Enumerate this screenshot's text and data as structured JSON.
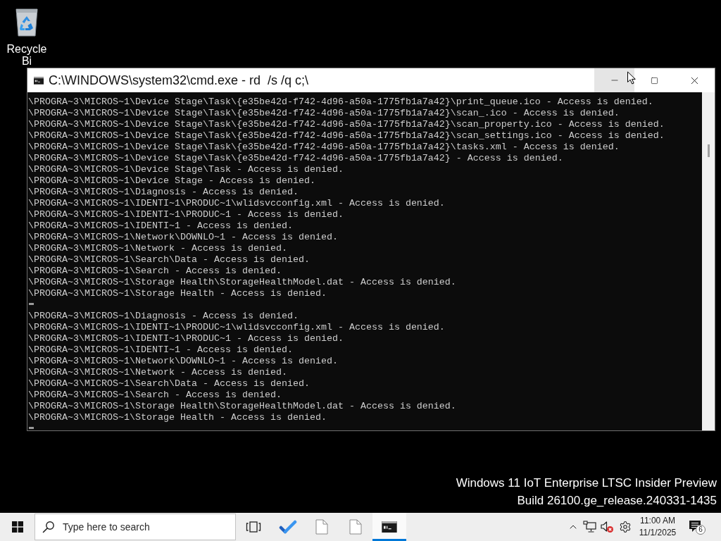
{
  "desktop_icons": [
    {
      "label": "Recycle Bi"
    }
  ],
  "console_window": {
    "title": "C:\\WINDOWS\\system32\\cmd.exe - rd  /s /q c;\\",
    "title_buttons": [
      {
        "kind": "minimize",
        "hovered": true
      },
      {
        "kind": "maximize",
        "hovered": false
      },
      {
        "kind": "close",
        "hovered": false
      }
    ],
    "lines": [
      {
        "kind": "text",
        "text": "\\PROGRA~3\\MICROS~1\\Device Stage\\Task\\{e35be42d-f742-4d96-a50a-1775fb1a7a42}\\print_queue.ico - Access is denied."
      },
      {
        "kind": "text",
        "text": "\\PROGRA~3\\MICROS~1\\Device Stage\\Task\\{e35be42d-f742-4d96-a50a-1775fb1a7a42}\\scan_.ico - Access is denied."
      },
      {
        "kind": "text",
        "text": "\\PROGRA~3\\MICROS~1\\Device Stage\\Task\\{e35be42d-f742-4d96-a50a-1775fb1a7a42}\\scan_property.ico - Access is denied."
      },
      {
        "kind": "text",
        "text": "\\PROGRA~3\\MICROS~1\\Device Stage\\Task\\{e35be42d-f742-4d96-a50a-1775fb1a7a42}\\scan_settings.ico - Access is denied."
      },
      {
        "kind": "text",
        "text": "\\PROGRA~3\\MICROS~1\\Device Stage\\Task\\{e35be42d-f742-4d96-a50a-1775fb1a7a42}\\tasks.xml - Access is denied."
      },
      {
        "kind": "text",
        "text": "\\PROGRA~3\\MICROS~1\\Device Stage\\Task\\{e35be42d-f742-4d96-a50a-1775fb1a7a42} - Access is denied."
      },
      {
        "kind": "text",
        "text": "\\PROGRA~3\\MICROS~1\\Device Stage\\Task - Access is denied."
      },
      {
        "kind": "text",
        "text": "\\PROGRA~3\\MICROS~1\\Device Stage - Access is denied."
      },
      {
        "kind": "text",
        "text": "\\PROGRA~3\\MICROS~1\\Diagnosis - Access is denied."
      },
      {
        "kind": "text",
        "text": "\\PROGRA~3\\MICROS~1\\IDENTI~1\\PRODUC~1\\wlidsvcconfig.xml - Access is denied."
      },
      {
        "kind": "text",
        "text": "\\PROGRA~3\\MICROS~1\\IDENTI~1\\PRODUC~1 - Access is denied."
      },
      {
        "kind": "text",
        "text": "\\PROGRA~3\\MICROS~1\\IDENTI~1 - Access is denied."
      },
      {
        "kind": "text",
        "text": "\\PROGRA~3\\MICROS~1\\Network\\DOWNLO~1 - Access is denied."
      },
      {
        "kind": "text",
        "text": "\\PROGRA~3\\MICROS~1\\Network - Access is denied."
      },
      {
        "kind": "text",
        "text": "\\PROGRA~3\\MICROS~1\\Search\\Data - Access is denied."
      },
      {
        "kind": "text",
        "text": "\\PROGRA~3\\MICROS~1\\Search - Access is denied."
      },
      {
        "kind": "text",
        "text": "\\PROGRA~3\\MICROS~1\\Storage Health\\StorageHealthModel.dat - Access is denied."
      },
      {
        "kind": "text",
        "text": "\\PROGRA~3\\MICROS~1\\Storage Health - Access is denied."
      },
      {
        "kind": "cursor"
      },
      {
        "kind": "text",
        "text": "\\PROGRA~3\\MICROS~1\\Diagnosis - Access is denied."
      },
      {
        "kind": "text",
        "text": "\\PROGRA~3\\MICROS~1\\IDENTI~1\\PRODUC~1\\wlidsvcconfig.xml - Access is denied."
      },
      {
        "kind": "text",
        "text": "\\PROGRA~3\\MICROS~1\\IDENTI~1\\PRODUC~1 - Access is denied."
      },
      {
        "kind": "text",
        "text": "\\PROGRA~3\\MICROS~1\\IDENTI~1 - Access is denied."
      },
      {
        "kind": "text",
        "text": "\\PROGRA~3\\MICROS~1\\Network\\DOWNLO~1 - Access is denied."
      },
      {
        "kind": "text",
        "text": "\\PROGRA~3\\MICROS~1\\Network - Access is denied."
      },
      {
        "kind": "text",
        "text": "\\PROGRA~3\\MICROS~1\\Search\\Data - Access is denied."
      },
      {
        "kind": "text",
        "text": "\\PROGRA~3\\MICROS~1\\Search - Access is denied."
      },
      {
        "kind": "text",
        "text": "\\PROGRA~3\\MICROS~1\\Storage Health\\StorageHealthModel.dat - Access is denied."
      },
      {
        "kind": "text",
        "text": "\\PROGRA~3\\MICROS~1\\Storage Health - Access is denied."
      },
      {
        "kind": "cursor"
      }
    ]
  },
  "build_info": [
    "Windows 11 IoT Enterprise LTSC Insider Preview",
    "Build 26100.ge_release.240331-1435"
  ],
  "taskbar": {
    "search": {
      "placeholder": "Type here to search"
    },
    "apps": [
      {
        "kind": "todo",
        "selected": false
      },
      {
        "kind": "document",
        "selected": false
      },
      {
        "kind": "document",
        "selected": false
      },
      {
        "kind": "console",
        "selected": true
      }
    ],
    "tray": {
      "volume_muted": true,
      "time": "11:00 AM",
      "date": "11/1/2025",
      "notification_count": "6"
    }
  }
}
